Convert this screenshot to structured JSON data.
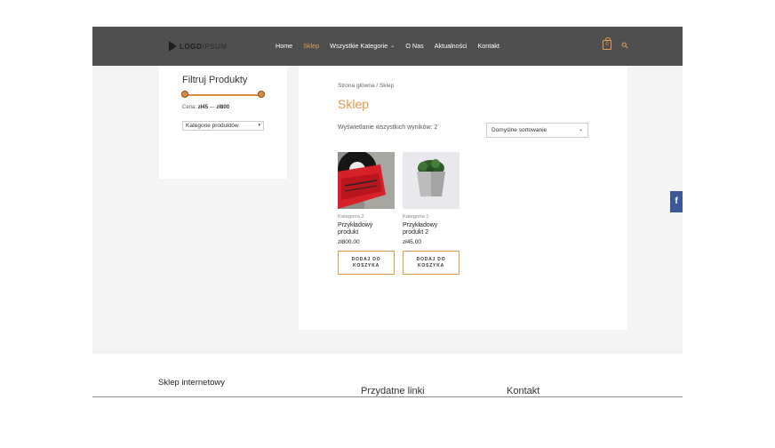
{
  "header": {
    "logo_bold": "LOGO",
    "logo_light": "IPSUM",
    "nav": [
      {
        "label": "Home",
        "active": false,
        "caret": false
      },
      {
        "label": "Sklep",
        "active": true,
        "caret": false
      },
      {
        "label": "Wszystkie Kategorie",
        "active": false,
        "caret": true
      },
      {
        "label": "O Nas",
        "active": false,
        "caret": false
      },
      {
        "label": "Aktualności",
        "active": false,
        "caret": false
      },
      {
        "label": "Kontakt",
        "active": false,
        "caret": false
      }
    ],
    "caret_glyph": "⌄",
    "cart_count": "0"
  },
  "sidebar": {
    "title": "Filtruj Produkty",
    "price_label": "Cena:",
    "price_min": "zł45",
    "price_sep": "—",
    "price_max": "zł800",
    "category_select": "Kategorie produktów",
    "select_arrow": "▾"
  },
  "main": {
    "breadcrumb": "Strona główna / Sklep",
    "title": "Sklep",
    "results": "Wyświetlanie wszystkich wyników: 2",
    "sort": "Domyślne sortowanie",
    "sort_arrow": "⌄",
    "products": [
      {
        "category": "Kategoria 2",
        "name": "Przykładowy produkt",
        "price": "zł800.00",
        "button": "DODAJ DO KOSZYKA"
      },
      {
        "category": "Kategoria 1",
        "name": "Przykładowy produkt 2",
        "price": "zł45.00",
        "button": "DODAJ DO KOSZYKA"
      }
    ]
  },
  "footer": {
    "col1_title": "Sklep internetowy",
    "col2_title": "Przydatne linki",
    "col3_title": "Kontakt"
  },
  "social": {
    "facebook_glyph": "f"
  },
  "colors": {
    "accent": "#e39a4b",
    "header_bg": "#4f4f4f",
    "page_bg": "#f4f4f4",
    "facebook": "#3b5998"
  },
  "icons": [
    "logo-mark-icon",
    "cart-icon",
    "search-icon",
    "chevron-down-icon",
    "facebook-icon"
  ]
}
